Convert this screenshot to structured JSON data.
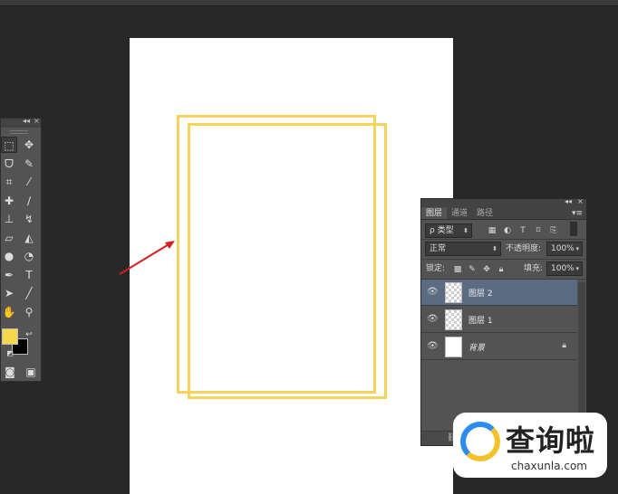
{
  "tools_panel": {
    "header_collapse": "◂◂",
    "header_close": "×",
    "tools": [
      {
        "name": "rect-marquee-icon",
        "glyph": "⬚"
      },
      {
        "name": "move-icon",
        "glyph": "✥"
      },
      {
        "name": "lasso-icon",
        "glyph": "ᗜ"
      },
      {
        "name": "quick-select-icon",
        "glyph": "✎"
      },
      {
        "name": "crop-icon",
        "glyph": "⌗"
      },
      {
        "name": "eyedropper-icon",
        "glyph": "⁄"
      },
      {
        "name": "healing-brush-icon",
        "glyph": "✚"
      },
      {
        "name": "brush-icon",
        "glyph": "∕"
      },
      {
        "name": "stamp-icon",
        "glyph": "⊥"
      },
      {
        "name": "history-brush-icon",
        "glyph": "↯"
      },
      {
        "name": "eraser-icon",
        "glyph": "▱"
      },
      {
        "name": "paint-bucket-icon",
        "glyph": "◭"
      },
      {
        "name": "blur-icon",
        "glyph": "●"
      },
      {
        "name": "dodge-icon",
        "glyph": "◔"
      },
      {
        "name": "pen-icon",
        "glyph": "✒"
      },
      {
        "name": "type-icon",
        "glyph": "T"
      },
      {
        "name": "path-select-icon",
        "glyph": "➤"
      },
      {
        "name": "line-icon",
        "glyph": "╱"
      },
      {
        "name": "hand-icon",
        "glyph": "✋"
      },
      {
        "name": "zoom-icon",
        "glyph": "⚲"
      }
    ],
    "foreground_color": "#f7d84a",
    "background_color": "#000000"
  },
  "layers_panel": {
    "tabs": [
      "图层",
      "通道",
      "路径"
    ],
    "filter_kind": "ρ 类型",
    "blend_mode": "正常",
    "opacity_label": "不透明度:",
    "opacity_value": "100%",
    "lock_label": "锁定:",
    "fill_label": "填充:",
    "fill_value": "100%",
    "layers": [
      {
        "name": "图层 2",
        "active": true
      },
      {
        "name": "图层 1",
        "active": false
      },
      {
        "name": "背景",
        "active": false
      }
    ]
  },
  "colors": {
    "frame_stroke": "#f5d35c",
    "arrow": "#d32020",
    "active_layer": "#5a6b82"
  },
  "watermark": {
    "brand": "查询啦",
    "url": "chaxunla.com"
  }
}
